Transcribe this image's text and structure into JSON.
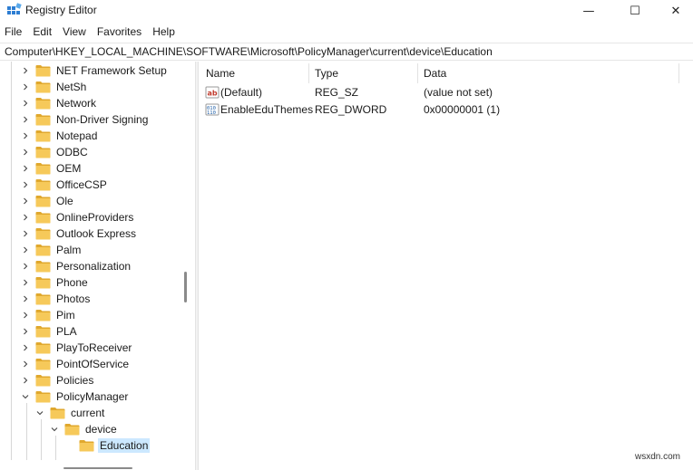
{
  "window": {
    "title": "Registry Editor",
    "minimize_glyph": "—",
    "maximize_glyph": "☐",
    "close_glyph": "✕"
  },
  "menu": [
    "File",
    "Edit",
    "View",
    "Favorites",
    "Help"
  ],
  "address": "Computer\\HKEY_LOCAL_MACHINE\\SOFTWARE\\Microsoft\\PolicyManager\\current\\device\\Education",
  "tree": {
    "items": [
      {
        "label": "NET Framework Setup",
        "expanded": false
      },
      {
        "label": "NetSh",
        "expanded": false
      },
      {
        "label": "Network",
        "expanded": false
      },
      {
        "label": "Non-Driver Signing",
        "expanded": false
      },
      {
        "label": "Notepad",
        "expanded": false
      },
      {
        "label": "ODBC",
        "expanded": false
      },
      {
        "label": "OEM",
        "expanded": false
      },
      {
        "label": "OfficeCSP",
        "expanded": false
      },
      {
        "label": "Ole",
        "expanded": false
      },
      {
        "label": "OnlineProviders",
        "expanded": false
      },
      {
        "label": "Outlook Express",
        "expanded": false
      },
      {
        "label": "Palm",
        "expanded": false
      },
      {
        "label": "Personalization",
        "expanded": false
      },
      {
        "label": "Phone",
        "expanded": false
      },
      {
        "label": "Photos",
        "expanded": false
      },
      {
        "label": "Pim",
        "expanded": false
      },
      {
        "label": "PLA",
        "expanded": false
      },
      {
        "label": "PlayToReceiver",
        "expanded": false
      },
      {
        "label": "PointOfService",
        "expanded": false
      },
      {
        "label": "Policies",
        "expanded": false
      },
      {
        "label": "PolicyManager",
        "expanded": true
      },
      {
        "label": "current",
        "expanded": true
      },
      {
        "label": "device",
        "expanded": true
      },
      {
        "label": "Education",
        "expanded": false,
        "selected": true
      }
    ]
  },
  "list": {
    "columns": {
      "name": "Name",
      "type": "Type",
      "data": "Data"
    },
    "rows": [
      {
        "name": "(Default)",
        "type": "REG_SZ",
        "data": "(value not set)",
        "icon": "string-value-icon"
      },
      {
        "name": "EnableEduThemes",
        "type": "REG_DWORD",
        "data": "0x00000001 (1)",
        "icon": "binary-value-icon"
      }
    ]
  },
  "watermark": "wsxdn.com",
  "colors": {
    "selection": "#cce8ff",
    "folder": "#f2c14e",
    "folder_dark": "#e0a82e"
  }
}
